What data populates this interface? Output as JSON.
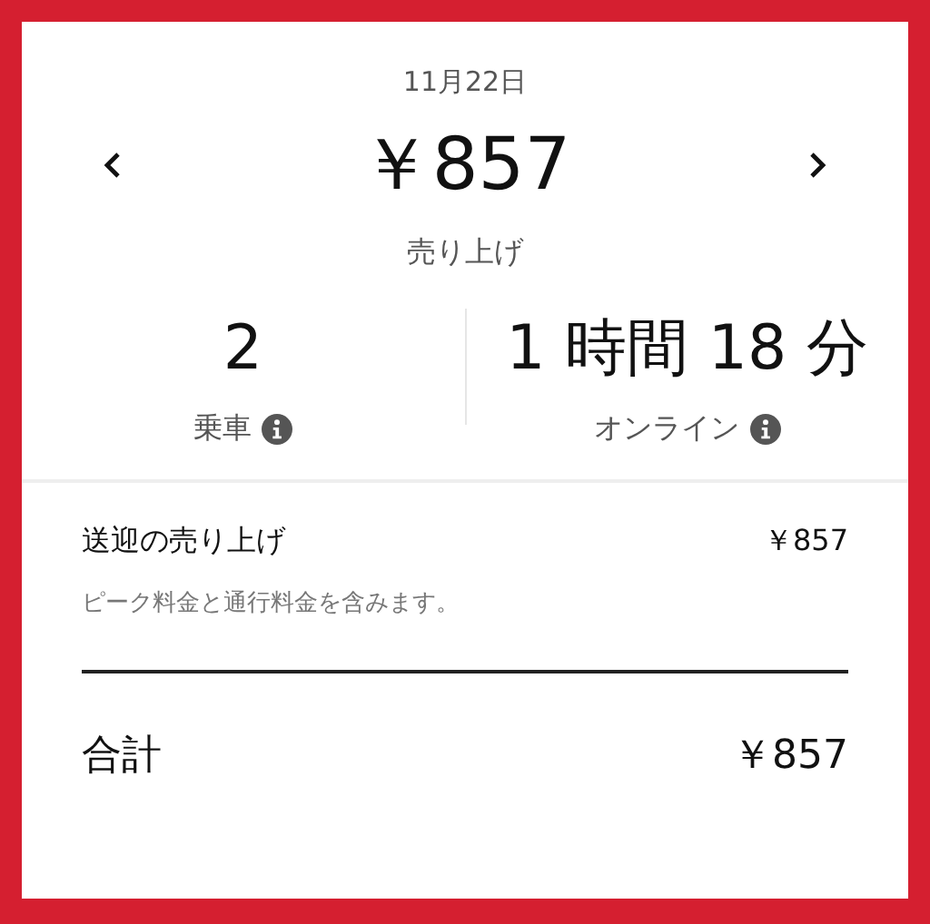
{
  "header": {
    "date": "11月22日",
    "amount": "￥857",
    "amount_label": "売り上げ"
  },
  "stats": [
    {
      "value": "2",
      "label": "乗車",
      "info": true
    },
    {
      "value": "1 時間 18 分",
      "label": "オンライン",
      "info": true
    }
  ],
  "breakdown": {
    "title": "送迎の売り上げ",
    "amount": "￥857",
    "note": "ピーク料金と通行料金を含みます。"
  },
  "total": {
    "label": "合計",
    "amount": "￥857"
  }
}
